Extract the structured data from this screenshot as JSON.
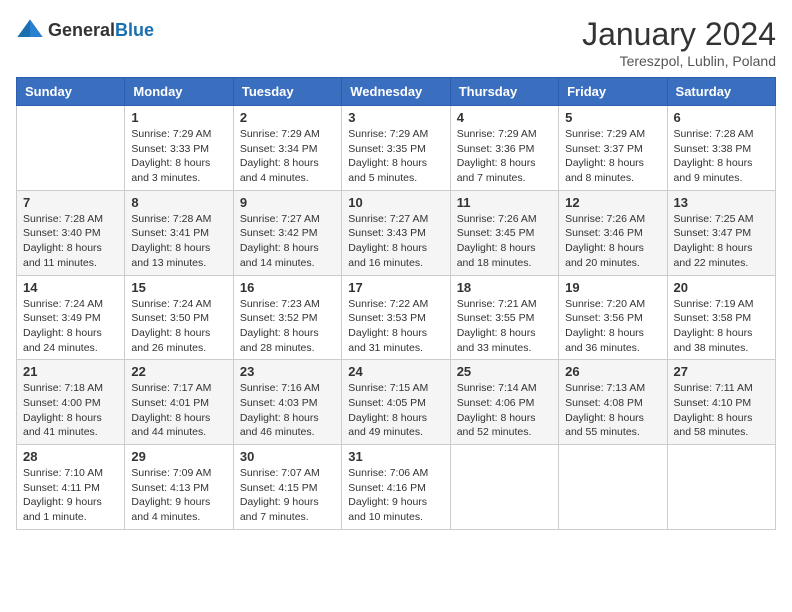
{
  "logo": {
    "text_general": "General",
    "text_blue": "Blue"
  },
  "title": "January 2024",
  "subtitle": "Tereszpol, Lublin, Poland",
  "days_of_week": [
    "Sunday",
    "Monday",
    "Tuesday",
    "Wednesday",
    "Thursday",
    "Friday",
    "Saturday"
  ],
  "weeks": [
    [
      {
        "day": "",
        "info": ""
      },
      {
        "day": "1",
        "info": "Sunrise: 7:29 AM\nSunset: 3:33 PM\nDaylight: 8 hours\nand 3 minutes."
      },
      {
        "day": "2",
        "info": "Sunrise: 7:29 AM\nSunset: 3:34 PM\nDaylight: 8 hours\nand 4 minutes."
      },
      {
        "day": "3",
        "info": "Sunrise: 7:29 AM\nSunset: 3:35 PM\nDaylight: 8 hours\nand 5 minutes."
      },
      {
        "day": "4",
        "info": "Sunrise: 7:29 AM\nSunset: 3:36 PM\nDaylight: 8 hours\nand 7 minutes."
      },
      {
        "day": "5",
        "info": "Sunrise: 7:29 AM\nSunset: 3:37 PM\nDaylight: 8 hours\nand 8 minutes."
      },
      {
        "day": "6",
        "info": "Sunrise: 7:28 AM\nSunset: 3:38 PM\nDaylight: 8 hours\nand 9 minutes."
      }
    ],
    [
      {
        "day": "7",
        "info": "Sunrise: 7:28 AM\nSunset: 3:40 PM\nDaylight: 8 hours\nand 11 minutes."
      },
      {
        "day": "8",
        "info": "Sunrise: 7:28 AM\nSunset: 3:41 PM\nDaylight: 8 hours\nand 13 minutes."
      },
      {
        "day": "9",
        "info": "Sunrise: 7:27 AM\nSunset: 3:42 PM\nDaylight: 8 hours\nand 14 minutes."
      },
      {
        "day": "10",
        "info": "Sunrise: 7:27 AM\nSunset: 3:43 PM\nDaylight: 8 hours\nand 16 minutes."
      },
      {
        "day": "11",
        "info": "Sunrise: 7:26 AM\nSunset: 3:45 PM\nDaylight: 8 hours\nand 18 minutes."
      },
      {
        "day": "12",
        "info": "Sunrise: 7:26 AM\nSunset: 3:46 PM\nDaylight: 8 hours\nand 20 minutes."
      },
      {
        "day": "13",
        "info": "Sunrise: 7:25 AM\nSunset: 3:47 PM\nDaylight: 8 hours\nand 22 minutes."
      }
    ],
    [
      {
        "day": "14",
        "info": "Sunrise: 7:24 AM\nSunset: 3:49 PM\nDaylight: 8 hours\nand 24 minutes."
      },
      {
        "day": "15",
        "info": "Sunrise: 7:24 AM\nSunset: 3:50 PM\nDaylight: 8 hours\nand 26 minutes."
      },
      {
        "day": "16",
        "info": "Sunrise: 7:23 AM\nSunset: 3:52 PM\nDaylight: 8 hours\nand 28 minutes."
      },
      {
        "day": "17",
        "info": "Sunrise: 7:22 AM\nSunset: 3:53 PM\nDaylight: 8 hours\nand 31 minutes."
      },
      {
        "day": "18",
        "info": "Sunrise: 7:21 AM\nSunset: 3:55 PM\nDaylight: 8 hours\nand 33 minutes."
      },
      {
        "day": "19",
        "info": "Sunrise: 7:20 AM\nSunset: 3:56 PM\nDaylight: 8 hours\nand 36 minutes."
      },
      {
        "day": "20",
        "info": "Sunrise: 7:19 AM\nSunset: 3:58 PM\nDaylight: 8 hours\nand 38 minutes."
      }
    ],
    [
      {
        "day": "21",
        "info": "Sunrise: 7:18 AM\nSunset: 4:00 PM\nDaylight: 8 hours\nand 41 minutes."
      },
      {
        "day": "22",
        "info": "Sunrise: 7:17 AM\nSunset: 4:01 PM\nDaylight: 8 hours\nand 44 minutes."
      },
      {
        "day": "23",
        "info": "Sunrise: 7:16 AM\nSunset: 4:03 PM\nDaylight: 8 hours\nand 46 minutes."
      },
      {
        "day": "24",
        "info": "Sunrise: 7:15 AM\nSunset: 4:05 PM\nDaylight: 8 hours\nand 49 minutes."
      },
      {
        "day": "25",
        "info": "Sunrise: 7:14 AM\nSunset: 4:06 PM\nDaylight: 8 hours\nand 52 minutes."
      },
      {
        "day": "26",
        "info": "Sunrise: 7:13 AM\nSunset: 4:08 PM\nDaylight: 8 hours\nand 55 minutes."
      },
      {
        "day": "27",
        "info": "Sunrise: 7:11 AM\nSunset: 4:10 PM\nDaylight: 8 hours\nand 58 minutes."
      }
    ],
    [
      {
        "day": "28",
        "info": "Sunrise: 7:10 AM\nSunset: 4:11 PM\nDaylight: 9 hours\nand 1 minute."
      },
      {
        "day": "29",
        "info": "Sunrise: 7:09 AM\nSunset: 4:13 PM\nDaylight: 9 hours\nand 4 minutes."
      },
      {
        "day": "30",
        "info": "Sunrise: 7:07 AM\nSunset: 4:15 PM\nDaylight: 9 hours\nand 7 minutes."
      },
      {
        "day": "31",
        "info": "Sunrise: 7:06 AM\nSunset: 4:16 PM\nDaylight: 9 hours\nand 10 minutes."
      },
      {
        "day": "",
        "info": ""
      },
      {
        "day": "",
        "info": ""
      },
      {
        "day": "",
        "info": ""
      }
    ]
  ]
}
